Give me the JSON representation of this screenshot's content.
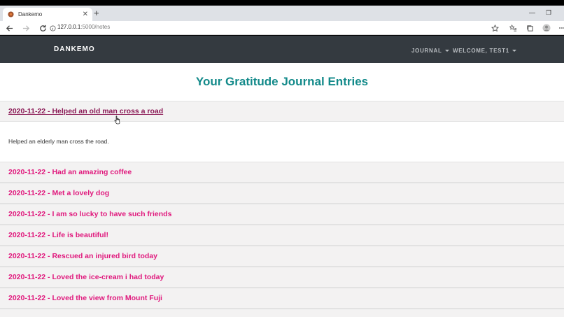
{
  "browser": {
    "tab_title": "Dankemo",
    "url_host": "127.0.0.1",
    "url_path": ":5000/notes"
  },
  "navbar": {
    "brand": "DANKEMO",
    "journal_label": "JOURNAL",
    "welcome_label": "WELCOME, TEST1"
  },
  "page": {
    "title": "Your Gratitude Journal Entries"
  },
  "entries": [
    {
      "title": "2020-11-22 - Helped an old man cross a road",
      "body": "Helped an elderly man cross the road."
    },
    {
      "title": "2020-11-22 - Had an amazing coffee"
    },
    {
      "title": "2020-11-22 - Met a lovely dog"
    },
    {
      "title": "2020-11-22 - I am so lucky to have such friends"
    },
    {
      "title": "2020-11-22 - Life is beautiful!"
    },
    {
      "title": "2020-11-22 - Rescued an injured bird today"
    },
    {
      "title": "2020-11-22 - Loved the ice-cream i had today"
    },
    {
      "title": "2020-11-22 - Loved the view from Mount Fuji"
    }
  ],
  "colors": {
    "accent_teal": "#138a8a",
    "entry_pink": "#e0197d",
    "entry_active": "#8b1a56",
    "navbar_bg": "#343a40"
  }
}
